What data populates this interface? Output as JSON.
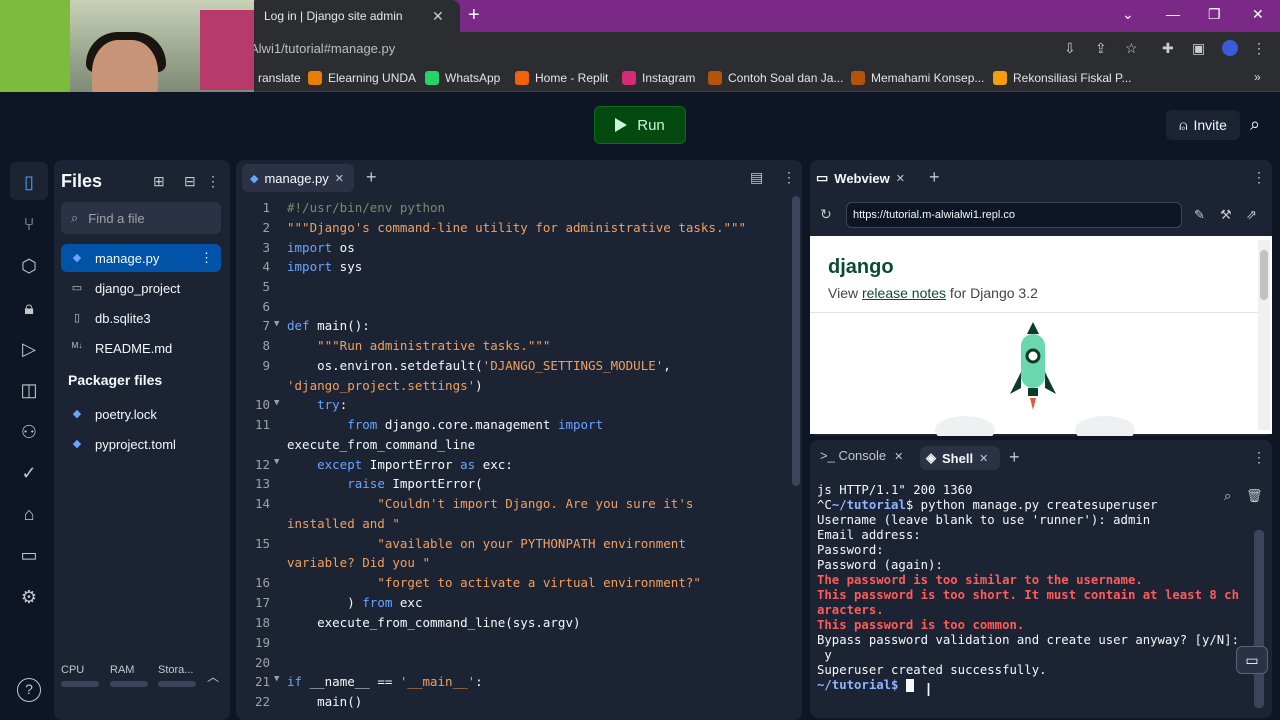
{
  "browser": {
    "tab_title": "Log in | Django site admin",
    "tab_close": "✕",
    "new_tab": "+",
    "url": "Alwi1/tutorial#manage.py",
    "bookmarks": [
      {
        "label": "ranslate",
        "icon": "translate-icon",
        "color": "#4285f4"
      },
      {
        "label": "Elearning UNDA",
        "icon": "elearning-icon",
        "color": "#e87e04"
      },
      {
        "label": "WhatsApp",
        "icon": "whatsapp-icon",
        "color": "#25d366"
      },
      {
        "label": "Home - Replit",
        "icon": "replit-icon",
        "color": "#f26207"
      },
      {
        "label": "Instagram",
        "icon": "instagram-icon",
        "color": "#d62976"
      },
      {
        "label": "Contoh Soal dan Ja...",
        "icon": "doc-icon",
        "color": "#b45309"
      },
      {
        "label": "Memahami Konsep...",
        "icon": "doc-icon",
        "color": "#b45309"
      },
      {
        "label": "Rekonsiliasi Fiskal P...",
        "icon": "check-icon",
        "color": "#f59e0b"
      }
    ]
  },
  "topbar": {
    "run_label": "Run",
    "invite_label": "Invite"
  },
  "files": {
    "title": "Files",
    "search_placeholder": "Find a file",
    "items": [
      {
        "label": "manage.py",
        "icon": "python-icon"
      },
      {
        "label": "django_project",
        "icon": "folder-icon"
      },
      {
        "label": "db.sqlite3",
        "icon": "file-icon"
      },
      {
        "label": "README.md",
        "icon": "markdown-icon"
      }
    ],
    "packager_title": "Packager files",
    "packager_items": [
      {
        "label": "poetry.lock",
        "icon": "python-icon"
      },
      {
        "label": "pyproject.toml",
        "icon": "python-icon"
      }
    ],
    "resources": {
      "cpu": "CPU",
      "ram": "RAM",
      "storage": "Stora..."
    },
    "help": "?"
  },
  "editor": {
    "tab_label": "manage.py",
    "line_numbers": [
      "1",
      "2",
      "3",
      "4",
      "5",
      "6",
      "7",
      "8",
      "9",
      "",
      "10",
      "11",
      "",
      "12",
      "13",
      "14",
      "",
      "15",
      "",
      "16",
      "17",
      "18",
      "19",
      "20",
      "21",
      "22"
    ]
  },
  "webview": {
    "tab_label": "Webview",
    "url": "https://tutorial.m-alwialwi1.repl.co",
    "django_title": "django",
    "sub_prefix": "View ",
    "sub_link": "release notes",
    "sub_suffix": " for Django 3.2"
  },
  "shell": {
    "console_label": "Console",
    "shell_label": "Shell",
    "lines": [
      "js HTTP/1.1\" 200 1360",
      "Username (leave blank to use 'runner'): admin",
      "Email address:",
      "Password:",
      "Password (again):"
    ],
    "prompt1_prefix": "^C",
    "prompt": "~/tutorial",
    "prompt1_cmd": "$ python manage.py createsuperuser",
    "errors": [
      "The password is too similar to the username.",
      "This password is too short. It must contain at least 8 ch",
      "aracters.",
      "This password is too common."
    ],
    "bypass": "Bypass password validation and create user anyway? [y/N]:",
    "answer": " y",
    "success": "Superuser created successfully.",
    "prompt_end": "$ "
  }
}
